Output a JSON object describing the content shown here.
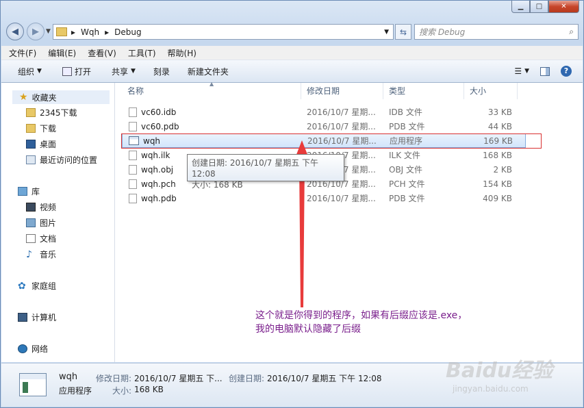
{
  "address": {
    "segments": [
      "Wqh",
      "Debug"
    ]
  },
  "search": {
    "placeholder": "搜索 Debug"
  },
  "menu": [
    "文件(F)",
    "编辑(E)",
    "查看(V)",
    "工具(T)",
    "帮助(H)"
  ],
  "toolbar": {
    "organize": "组织",
    "open": "打开",
    "share": "共享",
    "burn": "刻录",
    "new_folder": "新建文件夹"
  },
  "nav": {
    "favorites": "收藏夹",
    "fav_items": [
      "2345下载",
      "下载",
      "桌面",
      "最近访问的位置"
    ],
    "libraries": "库",
    "lib_items": [
      "视频",
      "图片",
      "文档",
      "音乐"
    ],
    "homegroup": "家庭组",
    "computer": "计算机",
    "network": "网络"
  },
  "columns": [
    "名称",
    "修改日期",
    "类型",
    "大小"
  ],
  "files": [
    {
      "name": "vc60.idb",
      "date": "2016/10/7 星期...",
      "type": "IDB 文件",
      "size": "33 KB"
    },
    {
      "name": "vc60.pdb",
      "date": "2016/10/7 星期...",
      "type": "PDB 文件",
      "size": "44 KB"
    },
    {
      "name": "wqh",
      "date": "2016/10/7 星期...",
      "type": "应用程序",
      "size": "169 KB"
    },
    {
      "name": "wqh.ilk",
      "date": "2016/10/7 星期...",
      "type": "ILK 文件",
      "size": "168 KB"
    },
    {
      "name": "wqh.obj",
      "date": "2016/10/7 星期...",
      "type": "OBJ 文件",
      "size": "2 KB"
    },
    {
      "name": "wqh.pch",
      "date": "2016/10/7 星期...",
      "type": "PCH 文件",
      "size": "154 KB"
    },
    {
      "name": "wqh.pdb",
      "date": "2016/10/7 星期...",
      "type": "PDB 文件",
      "size": "409 KB"
    }
  ],
  "tooltip": {
    "line1": "创建日期: 2016/10/7 星期五 下午 12:08",
    "line2": "大小: 168 KB"
  },
  "annotation": {
    "line1": "这个就是你得到的程序，如果有后缀应该是.exe，",
    "line2": "我的电脑默认隐藏了后缀"
  },
  "details": {
    "name": "wqh",
    "type": "应用程序",
    "modified_label": "修改日期:",
    "modified_value": "2016/10/7 星期五 下...",
    "created_label": "创建日期:",
    "created_value": "2016/10/7 星期五 下午 12:08",
    "size_label": "大小:",
    "size_value": "168 KB"
  },
  "watermark": {
    "main": "Baidu经验",
    "sub": "jingyan.baidu.com"
  },
  "colors": {
    "accent": "#3c7fb1",
    "annotation": "#7a1f8c",
    "highlight_box": "#d93030"
  }
}
